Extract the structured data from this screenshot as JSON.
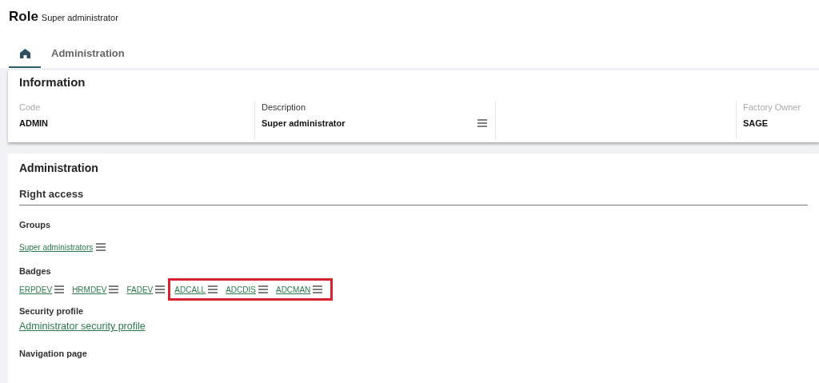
{
  "page": {
    "title": "Role",
    "subtitle": "Super administrator"
  },
  "tabs": [
    {
      "kind": "home",
      "selected": true
    },
    {
      "kind": "text",
      "label": "Administration",
      "selected": false
    }
  ],
  "information": {
    "title": "Information",
    "fields": [
      {
        "kind": "field",
        "label": "Code",
        "value": "ADMIN",
        "disabled": true,
        "menu": false
      },
      {
        "kind": "field",
        "label": "Description",
        "value": "Super administrator",
        "disabled": false,
        "menu": true
      },
      {
        "kind": "empty"
      },
      {
        "kind": "field",
        "label": "Factory Owner",
        "value": "SAGE",
        "disabled": true,
        "menu": false
      }
    ]
  },
  "administration": {
    "title": "Administration",
    "subtitle": "Right access",
    "groups": {
      "label": "Groups",
      "items": [
        {
          "text": "Super administrators"
        }
      ]
    },
    "badges": {
      "label": "Badges",
      "items": [
        {
          "text": "ERPDEV",
          "highlighted": false
        },
        {
          "text": "HRMDEV",
          "highlighted": false
        },
        {
          "text": "FADEV",
          "highlighted": false
        },
        {
          "text": "ADCALL",
          "highlighted": true
        },
        {
          "text": "ADCDIS",
          "highlighted": true
        },
        {
          "text": "ADCMAN",
          "highlighted": true
        }
      ]
    },
    "security_profile": {
      "label": "Security profile",
      "link": "Administrator security profile"
    },
    "navigation_page": {
      "label": "Navigation page"
    }
  }
}
